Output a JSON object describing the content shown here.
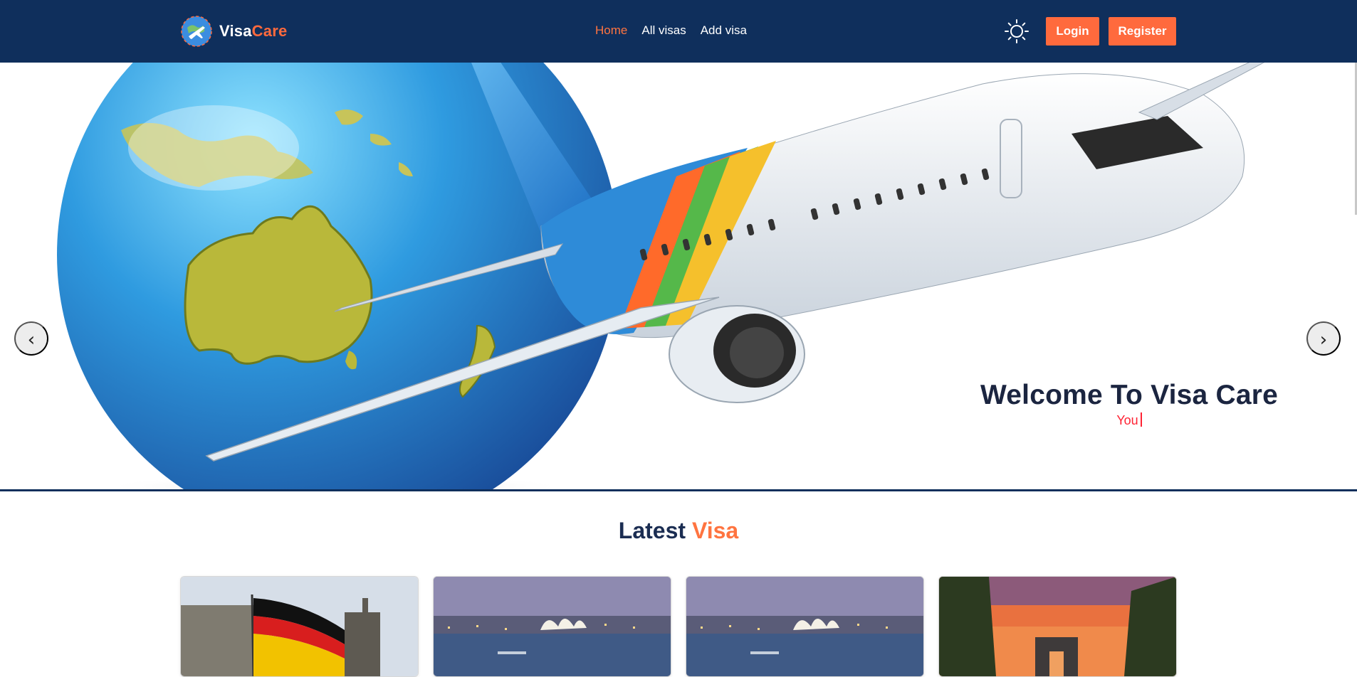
{
  "brand": {
    "name_part1": "Visa",
    "name_part2": "Care"
  },
  "nav": {
    "links": [
      {
        "label": "Home",
        "active": true
      },
      {
        "label": "All visas"
      },
      {
        "label": "Add visa"
      }
    ]
  },
  "header": {
    "theme_icon": "sun-icon",
    "login_label": "Login",
    "register_label": "Register"
  },
  "hero": {
    "title": "Welcome To Visa Care",
    "typed_text": "You",
    "prev_label": "‹",
    "next_label": "›"
  },
  "latest": {
    "title_part1": "Latest",
    "title_part2": "Visa",
    "cards": [
      {
        "image": "germany-flag-reichstag"
      },
      {
        "image": "sydney-opera-house-night"
      },
      {
        "image": "sydney-opera-house-night"
      },
      {
        "image": "arc-de-triomphe-sunset"
      }
    ]
  },
  "colors": {
    "navy": "#0f2f5c",
    "accent": "#ff6a3d",
    "typed": "#ff2233"
  }
}
